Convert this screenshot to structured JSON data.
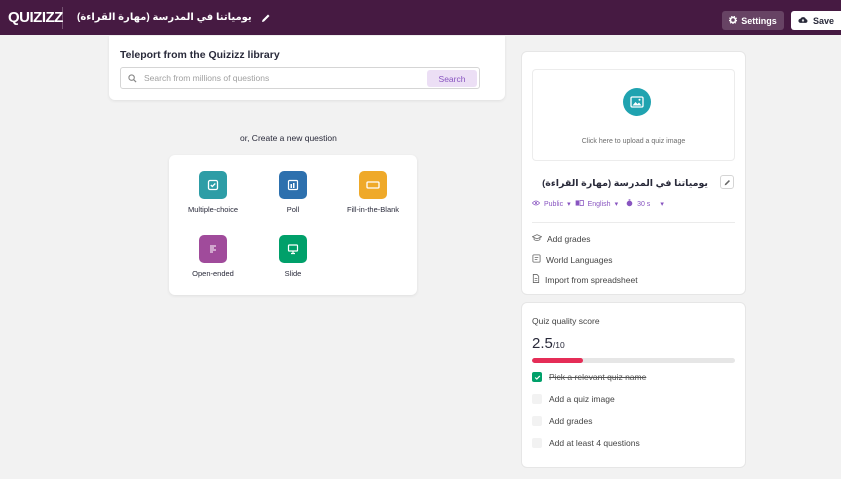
{
  "header": {
    "logo": "QUIZIZZ",
    "quiz_title": "يومياتنا في المدرسة (مهارة القراءة)",
    "settings_label": "Settings",
    "save_label": "Save"
  },
  "teleport": {
    "title": "Teleport from the Quizizz library",
    "search_placeholder": "Search from millions of questions",
    "search_button": "Search"
  },
  "create_label": "or, Create a new question",
  "question_types": [
    {
      "label": "Multiple-choice",
      "icon": "checkbox-icon",
      "color": "#2d9da6"
    },
    {
      "label": "Poll",
      "icon": "poll-icon",
      "color": "#2d70ae"
    },
    {
      "label": "Fill-in-the-Blank",
      "icon": "blank-icon",
      "color": "#efa929"
    },
    {
      "label": "Open-ended",
      "icon": "text-lines-icon",
      "color": "#d5546d"
    },
    {
      "label": "Slide",
      "icon": "presentation-icon",
      "color": "#00a06a"
    }
  ],
  "sidebar": {
    "upload_text": "Click here to upload a quiz image",
    "quiz_name": "يومياتنا في المدرسة (مهارة القراءة)",
    "visibility": "Public",
    "language": "English",
    "time": "30 s",
    "links": [
      "Add grades",
      "World Languages",
      "Import from spreadsheet"
    ]
  },
  "quality": {
    "title": "Quiz quality score",
    "score": "2.5",
    "out_of": "/10",
    "progress": 0.25,
    "items": [
      {
        "label": "Pick a relevant quiz name",
        "done": true
      },
      {
        "label": "Add a quiz image",
        "done": false
      },
      {
        "label": "Add grades",
        "done": false
      },
      {
        "label": "Add at least 4 questions",
        "done": false
      }
    ]
  },
  "colors": {
    "brand": "#461a42",
    "accent": "#8854c0",
    "upload": "#20a3b0",
    "score_bar": "#e52d57"
  }
}
